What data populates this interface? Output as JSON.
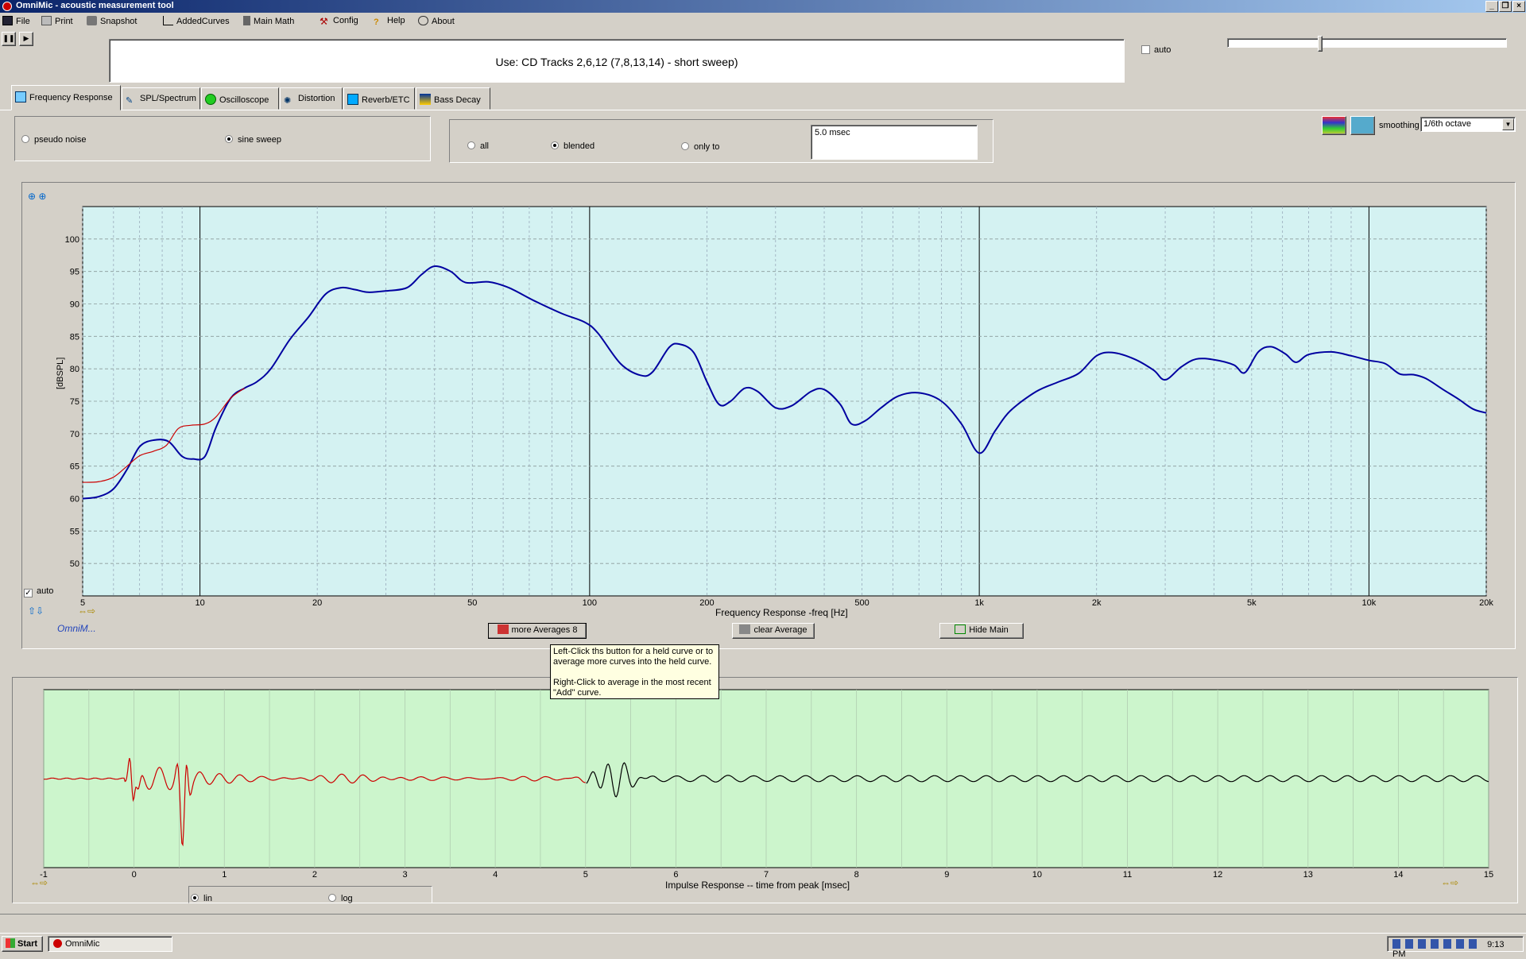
{
  "window": {
    "title": "OmniMic - acoustic measurement tool"
  },
  "menu": [
    {
      "label": "File",
      "icon": "floppy-icon"
    },
    {
      "label": "Print",
      "icon": "printer-icon"
    },
    {
      "label": "Snapshot",
      "icon": "camera-icon"
    },
    {
      "label": "AddedCurves",
      "icon": "curves-icon"
    },
    {
      "label": "Main Math",
      "icon": "calculator-icon"
    },
    {
      "label": "Config",
      "icon": "tools-icon"
    },
    {
      "label": "Help",
      "icon": "question-icon"
    },
    {
      "label": "About",
      "icon": "speech-bubble-icon"
    }
  ],
  "header": {
    "instruction": "Use: CD Tracks 2,6,12 (7,8,13,14) - short sweep)",
    "auto_label": "auto",
    "auto_checked": false
  },
  "tabs": [
    {
      "label": "Frequency Response",
      "active": true
    },
    {
      "label": "SPL/Spectrum",
      "active": false
    },
    {
      "label": "Oscilloscope",
      "active": false
    },
    {
      "label": "Distortion",
      "active": false
    },
    {
      "label": "Reverb/ETC",
      "active": false
    },
    {
      "label": "Bass Decay",
      "active": false
    }
  ],
  "signal": {
    "pseudo_noise": "pseudo noise",
    "sine_sweep": "sine sweep",
    "selected": "sine sweep"
  },
  "window_mode": {
    "all": "all",
    "blended": "blended",
    "only_to": "only to",
    "selected": "blended",
    "time_value": "5.0 msec"
  },
  "smoothing": {
    "label": "smoothing",
    "value": "1/6th octave"
  },
  "fr_chart_auto_label": "auto",
  "buttons": {
    "more_averages": "more Averages 8",
    "clear_average": "clear Average",
    "hide_main": "Hide Main"
  },
  "logo_text": "OmniM...",
  "tooltip": {
    "line1": "Left-Click ths button for a held curve or to",
    "line2": "average more curves into the held curve.",
    "line3": "Right-Click to average in the most recent",
    "line4": "\"Add\" curve."
  },
  "ir_scale": {
    "lin": "lin",
    "log": "log",
    "selected": "lin"
  },
  "taskbar": {
    "start": "Start",
    "app": "OmniMic",
    "clock": "9:13 PM"
  },
  "chart_data": [
    {
      "type": "line",
      "title": "",
      "xlabel": "Frequency Response -freq [Hz]",
      "ylabel": "[dBSPL]",
      "x_scale": "log",
      "xlim": [
        5,
        20000
      ],
      "ylim": [
        45,
        105
      ],
      "x_ticks": [
        5,
        10,
        20,
        50,
        100,
        200,
        500,
        1000,
        2000,
        5000,
        10000,
        20000
      ],
      "x_tick_labels": [
        "5",
        "10",
        "20",
        "50",
        "100",
        "200",
        "500",
        "1k",
        "2k",
        "5k",
        "10k",
        "20k"
      ],
      "y_ticks": [
        50,
        55,
        60,
        65,
        70,
        75,
        80,
        85,
        90,
        95,
        100
      ],
      "grid": true,
      "series": [
        {
          "color": "#0000a0",
          "points": [
            [
              5,
              60
            ],
            [
              5.5,
              60.3
            ],
            [
              6,
              61.5
            ],
            [
              6.5,
              64.5
            ],
            [
              7,
              68
            ],
            [
              7.6,
              69
            ],
            [
              8.3,
              68.8
            ],
            [
              9,
              66.5
            ],
            [
              9.6,
              66.1
            ],
            [
              10.3,
              66.5
            ],
            [
              11,
              71
            ],
            [
              12,
              75.5
            ],
            [
              13,
              77
            ],
            [
              14,
              78
            ],
            [
              15.2,
              80
            ],
            [
              17,
              84.5
            ],
            [
              19,
              88
            ],
            [
              21,
              91.5
            ],
            [
              23,
              92.5
            ],
            [
              25,
              92.2
            ],
            [
              27,
              91.8
            ],
            [
              30,
              92
            ],
            [
              34,
              92.5
            ],
            [
              37,
              94.5
            ],
            [
              40,
              95.8
            ],
            [
              44,
              95
            ],
            [
              48,
              93.3
            ],
            [
              55,
              93.4
            ],
            [
              62,
              92.5
            ],
            [
              72,
              90.5
            ],
            [
              85,
              88.5
            ],
            [
              97,
              87.2
            ],
            [
              105,
              85.5
            ],
            [
              120,
              80.8
            ],
            [
              135,
              79
            ],
            [
              145,
              79.5
            ],
            [
              160,
              83.3
            ],
            [
              170,
              83.8
            ],
            [
              185,
              82.5
            ],
            [
              200,
              78
            ],
            [
              215,
              74.5
            ],
            [
              230,
              75
            ],
            [
              250,
              77
            ],
            [
              270,
              76.5
            ],
            [
              300,
              74
            ],
            [
              330,
              74.3
            ],
            [
              370,
              76.5
            ],
            [
              400,
              76.8
            ],
            [
              440,
              74.5
            ],
            [
              470,
              71.5
            ],
            [
              510,
              72
            ],
            [
              560,
              74
            ],
            [
              620,
              75.8
            ],
            [
              700,
              76.3
            ],
            [
              800,
              75
            ],
            [
              900,
              71.5
            ],
            [
              1000,
              67
            ],
            [
              1100,
              70.5
            ],
            [
              1200,
              73.5
            ],
            [
              1400,
              76.5
            ],
            [
              1600,
              78
            ],
            [
              1800,
              79.3
            ],
            [
              2000,
              82
            ],
            [
              2200,
              82.5
            ],
            [
              2500,
              81.5
            ],
            [
              2800,
              79.8
            ],
            [
              3000,
              78.3
            ],
            [
              3300,
              80.3
            ],
            [
              3600,
              81.5
            ],
            [
              4000,
              81.4
            ],
            [
              4500,
              80.6
            ],
            [
              4800,
              79.4
            ],
            [
              5200,
              82.6
            ],
            [
              5600,
              83.4
            ],
            [
              6100,
              82.3
            ],
            [
              6500,
              81
            ],
            [
              7000,
              82.2
            ],
            [
              8000,
              82.6
            ],
            [
              9000,
              82
            ],
            [
              10000,
              81.3
            ],
            [
              11000,
              80.8
            ],
            [
              12000,
              79.2
            ],
            [
              13000,
              79.1
            ],
            [
              14000,
              78.5
            ],
            [
              15500,
              76.8
            ],
            [
              17000,
              75.3
            ],
            [
              18500,
              73.8
            ],
            [
              20000,
              73.2
            ]
          ]
        },
        {
          "color": "#cc0000",
          "points": [
            [
              5,
              62.5
            ],
            [
              5.5,
              62.6
            ],
            [
              6,
              63.3
            ],
            [
              6.5,
              65
            ],
            [
              7,
              66.6
            ],
            [
              7.6,
              67.3
            ],
            [
              8.2,
              68.2
            ],
            [
              8.8,
              70.8
            ],
            [
              9.5,
              71.3
            ],
            [
              10.3,
              71.5
            ],
            [
              11,
              72.6
            ],
            [
              12,
              75.5
            ],
            [
              13,
              77
            ]
          ]
        }
      ]
    },
    {
      "type": "line",
      "title": "",
      "xlabel": "Impulse Response  -- time from peak [msec]",
      "ylabel": "",
      "xlim": [
        -1,
        15
      ],
      "x_ticks": [
        -1,
        0,
        1,
        2,
        3,
        4,
        5,
        6,
        7,
        8,
        9,
        10,
        11,
        12,
        13,
        14,
        15
      ],
      "grid": true,
      "series": [
        {
          "color": "#cc0000",
          "x_range": [
            -1,
            5
          ],
          "description_values": {
            "peak_time": 0,
            "peak_max": 1.0,
            "peak_min": -1.0,
            "second_peak_time": 0.55
          }
        },
        {
          "color": "#000000",
          "x_range": [
            5,
            15
          ]
        }
      ]
    }
  ]
}
